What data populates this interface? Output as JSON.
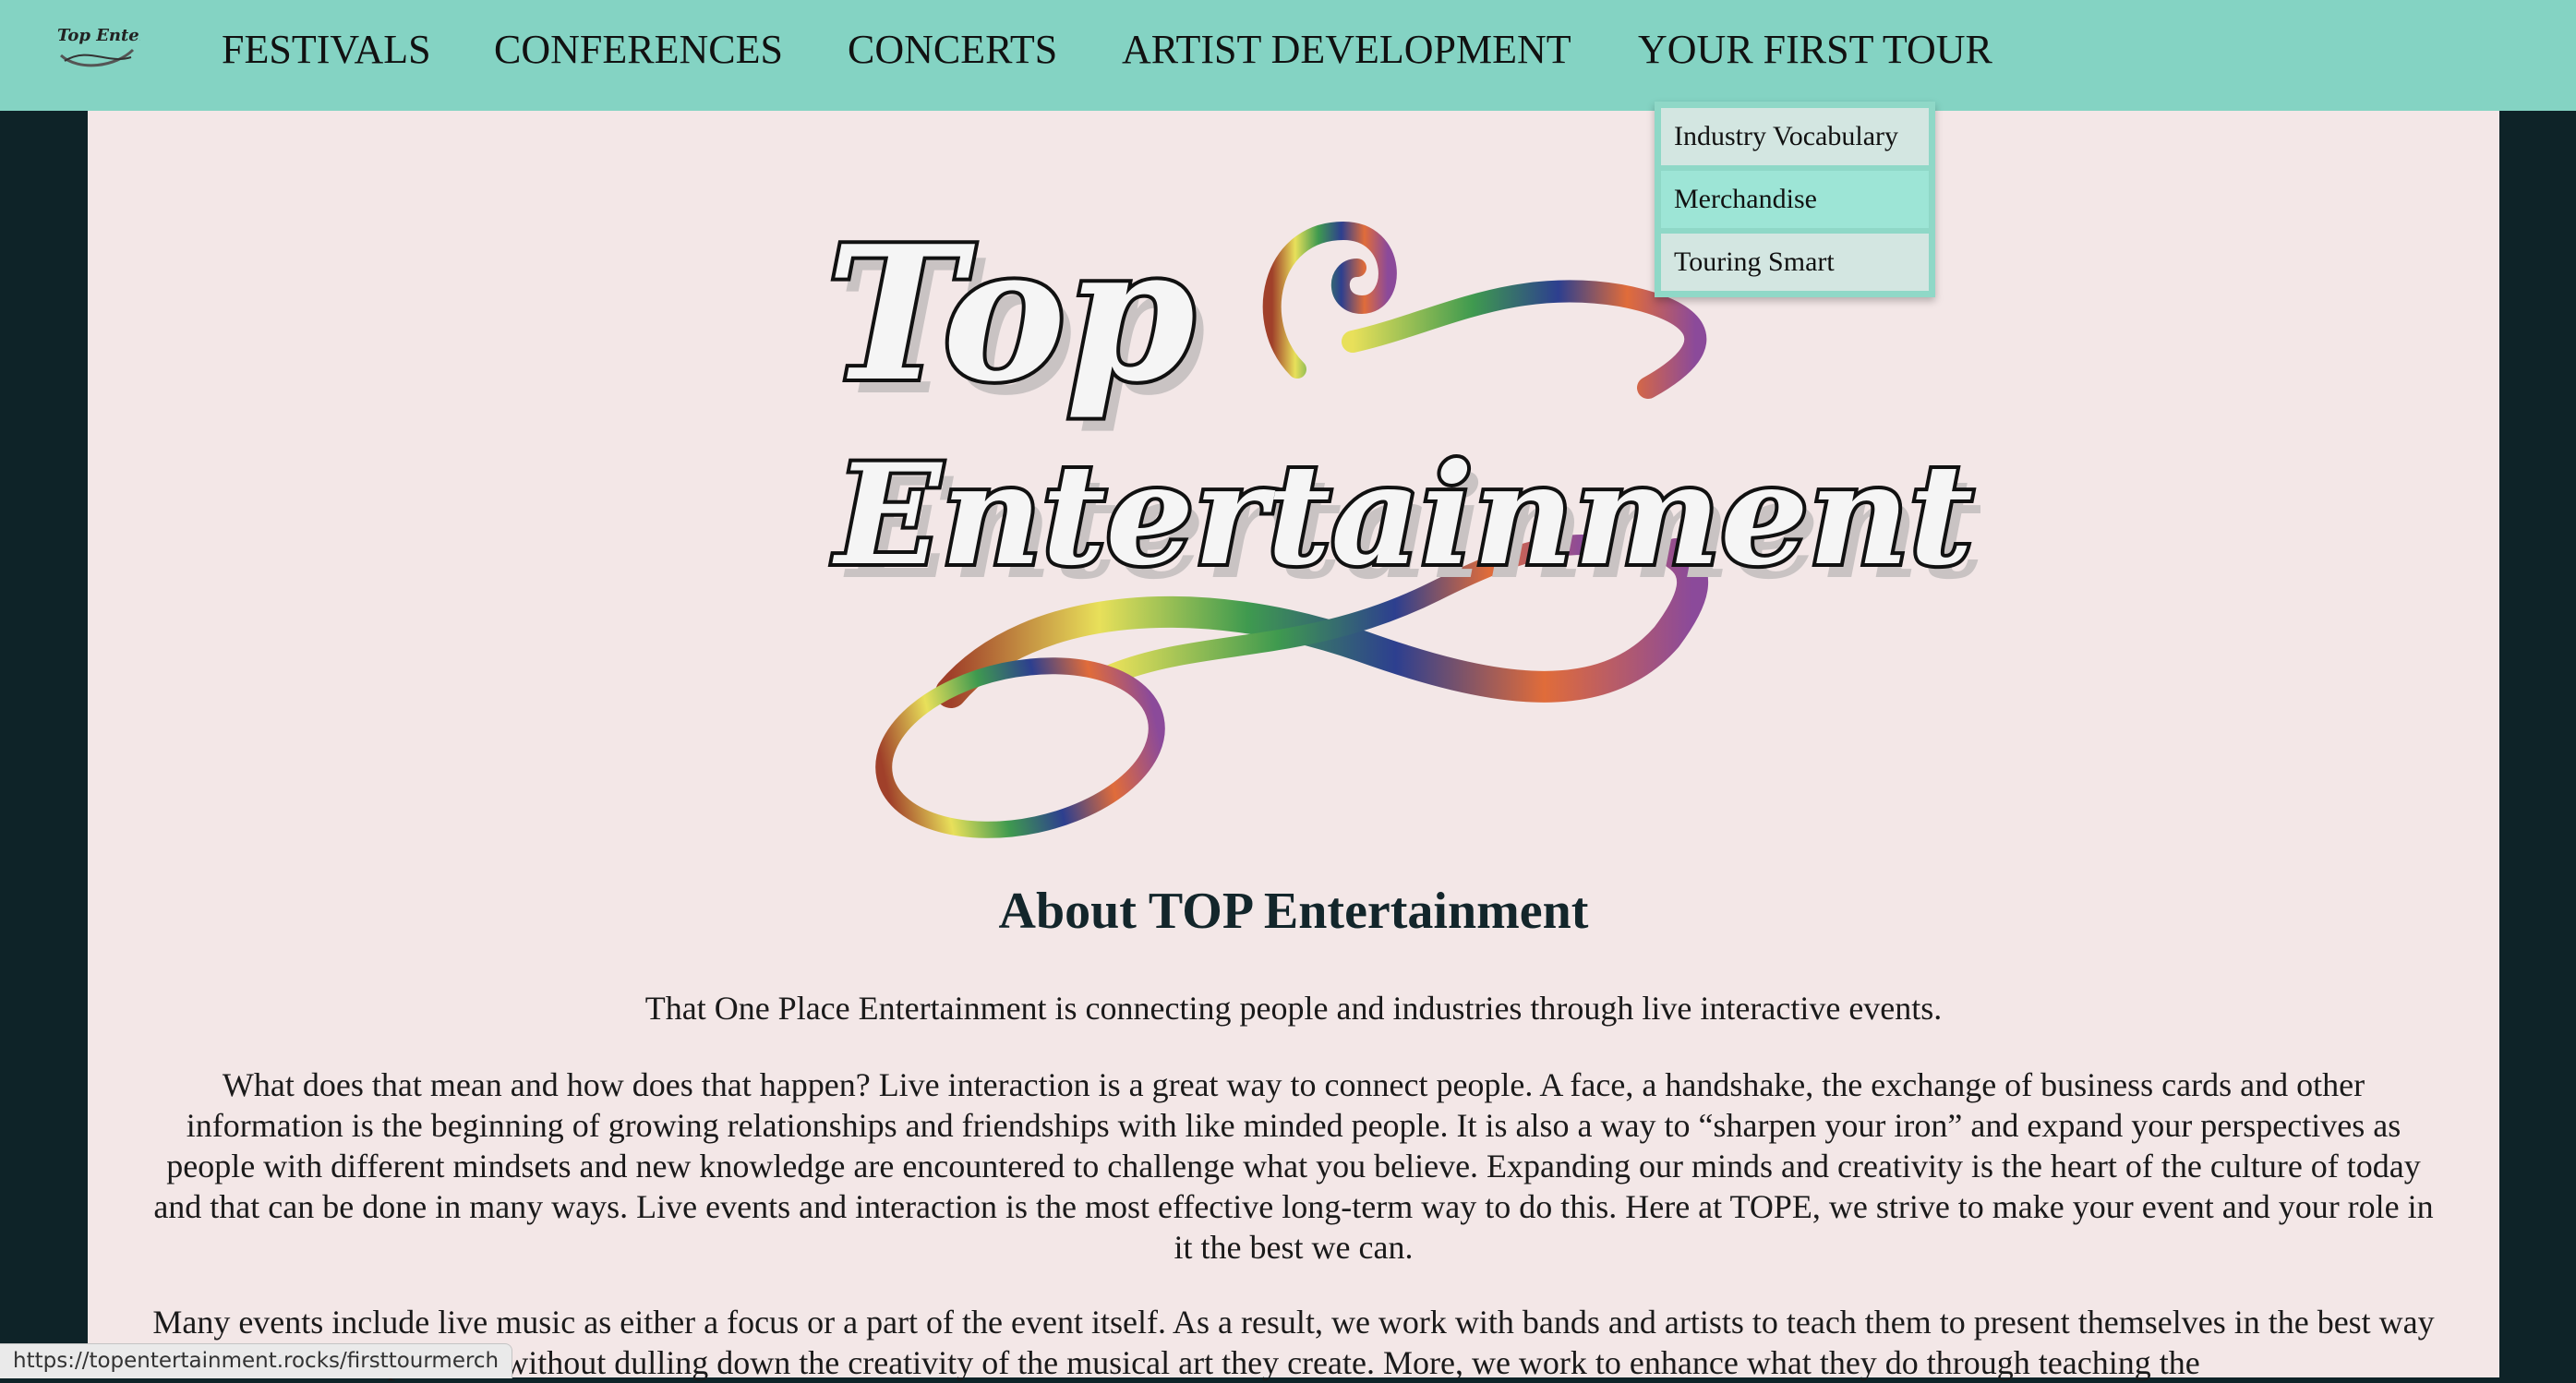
{
  "nav": {
    "logo_text": "Top Entertainment",
    "items": [
      "FESTIVALS",
      "CONFERENCES",
      "CONCERTS",
      "ARTIST DEVELOPMENT",
      "YOUR FIRST TOUR"
    ]
  },
  "dropdown": {
    "items": [
      "Industry Vocabulary",
      "Merchandise",
      "Touring Smart"
    ]
  },
  "hero": {
    "logo_line1": "Top",
    "logo_line2": "Entertainment"
  },
  "about": {
    "title": "About TOP Entertainment",
    "intro": "That One Place Entertainment is connecting people and industries through live interactive events.",
    "paragraph2": "What does that mean and how does that happen? Live interaction is a great way to connect people. A face, a handshake, the exchange of business cards and other information is the beginning of growing relationships and friendships with like minded people. It is also a way to “sharpen your iron” and expand your perspectives as people with different mindsets and new knowledge are encountered to challenge what you believe. Expanding our minds and creativity is the heart of the culture of today and that can be done in many ways. Live events and interaction is the most effective long-term way to do this. Here at TOPE, we strive to make your event and your role in it the best we can.",
    "paragraph3": "Many events include live music as either a focus or a part of the event itself. As a result, we work with bands and artists to teach them to present themselves in the best way possible without dulling down the creativity of the musical art they create. More, we work to enhance what they do through teaching the"
  },
  "status_bar": {
    "url": "https://topentertainment.rocks/firsttourmerch"
  },
  "colors": {
    "navbar_bg": "#84d3c3",
    "page_bg": "#0e2328",
    "content_bg": "#f3e7e7",
    "dropdown_bg": "#8fd8c7",
    "dropdown_item_bg": "#d3e6e1",
    "dropdown_item_hover_bg": "#9de5d6",
    "title_color": "#13262b"
  }
}
